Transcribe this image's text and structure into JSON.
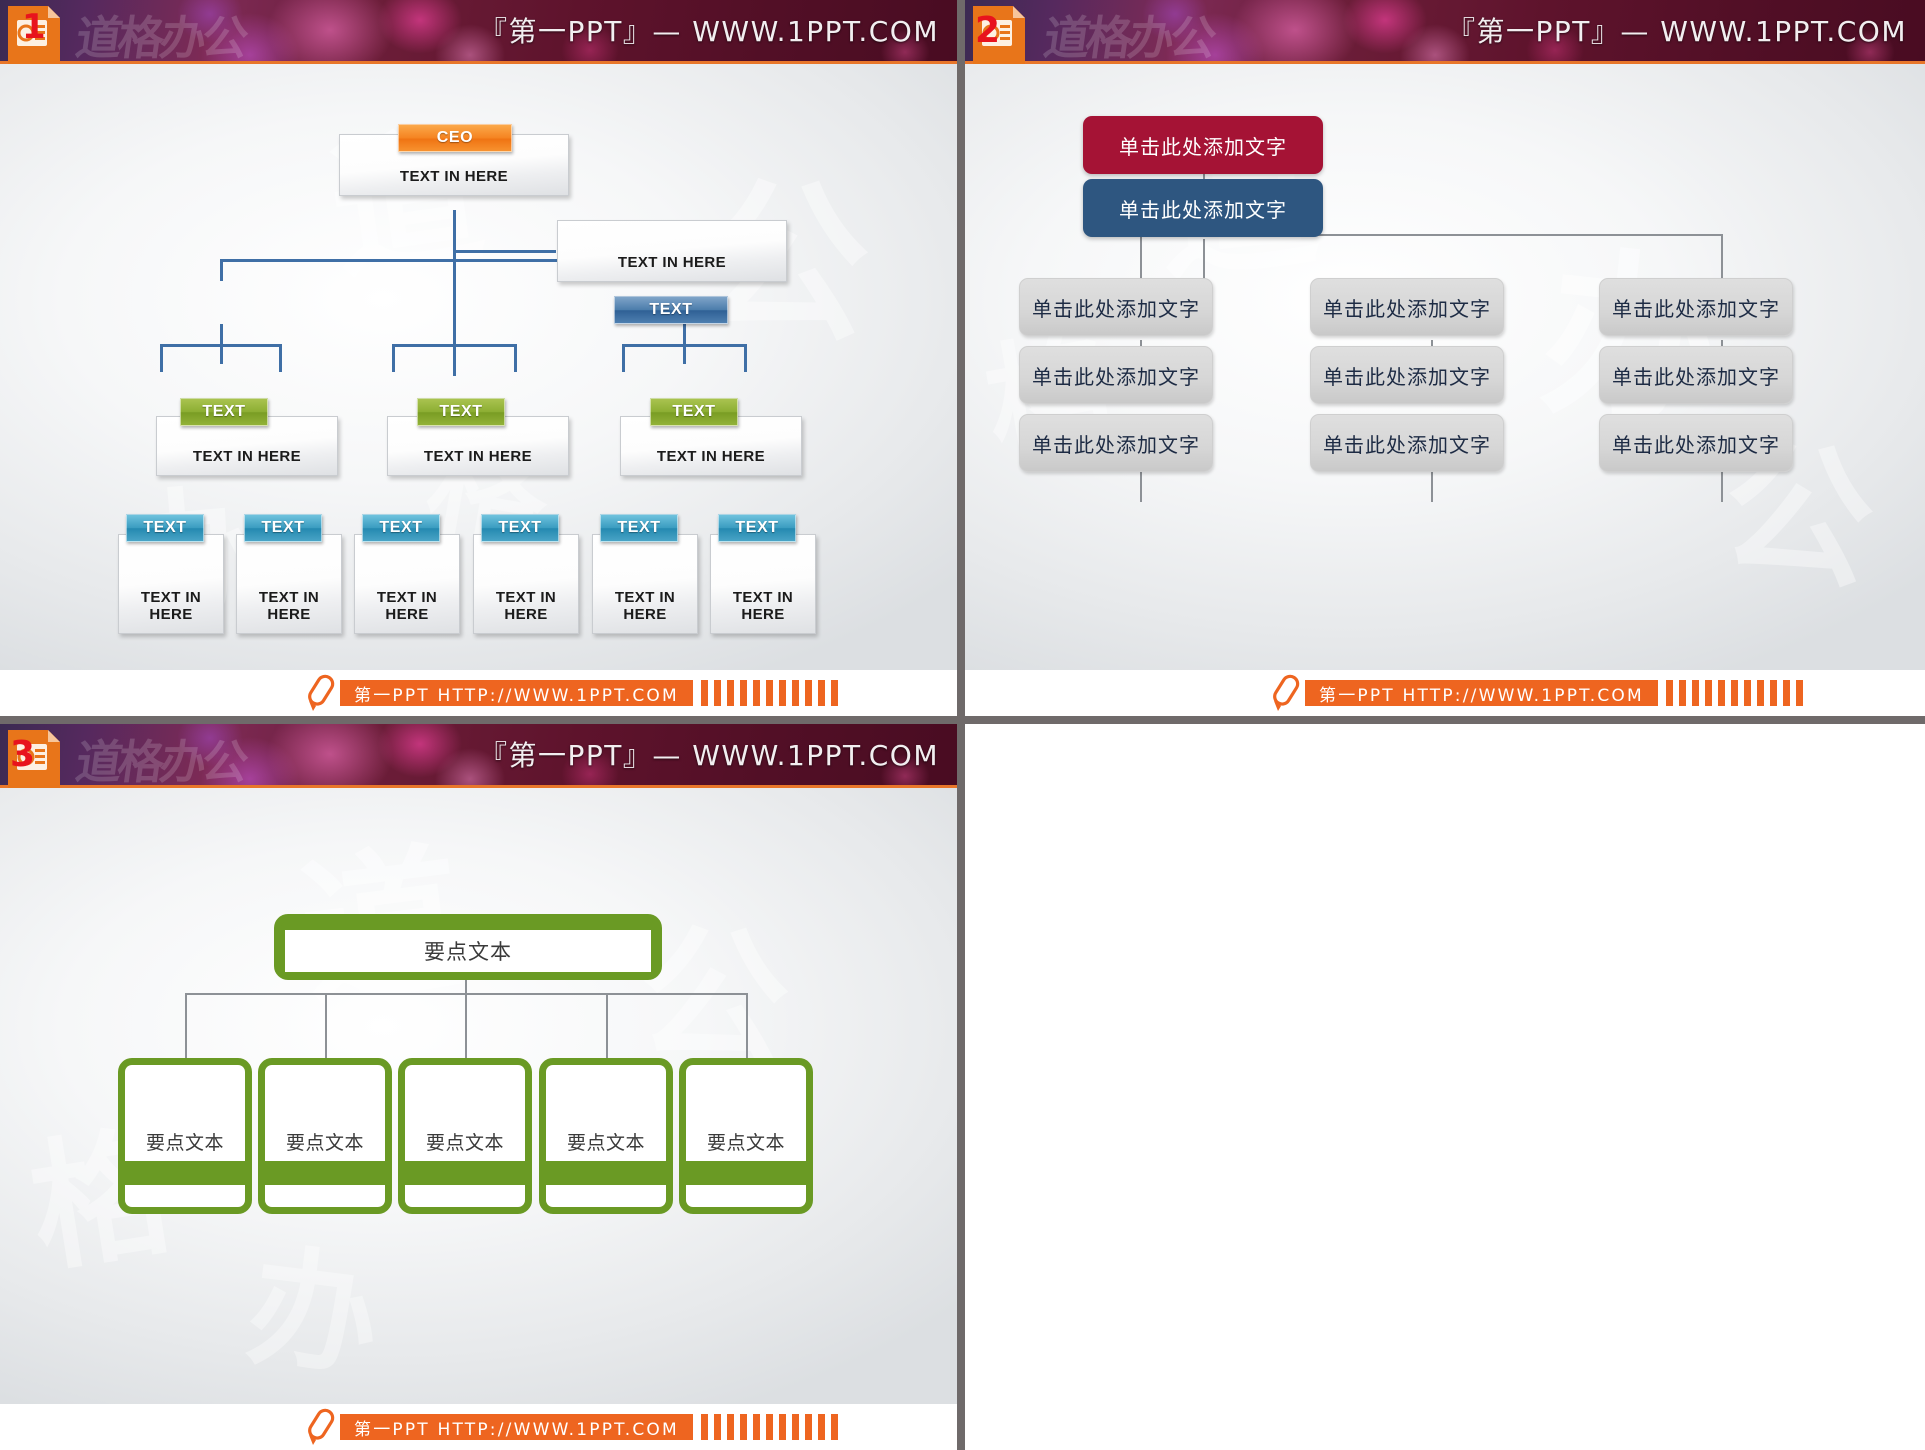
{
  "page": {
    "title": "PPT Organization Chart Template Collection",
    "grid_columns": 2,
    "grid_rows": 2,
    "empty_cell": "bottom-right"
  },
  "banner": {
    "title": "『第一PPT』— WWW.1PPT.COM",
    "watermark": "道格办公",
    "accent_line_color": "#e8762a"
  },
  "footer": {
    "bar_text": "第一PPT HTTP://WWW.1PPT.COM",
    "accent_color": "#ee6520",
    "pen_icon": "pen-icon",
    "tick_count": 11
  },
  "slides": [
    {
      "number": "1",
      "badge_icon": "powerpoint-file-icon",
      "chart_type": "organization-chart-tabbed",
      "colors": {
        "ceo_tab": "#f5821f",
        "level2_tab": "#2f6095",
        "level3_tab": "#8cae33",
        "level4_tab": "#2489b0",
        "connector": "#3f6fa6"
      },
      "nodes": {
        "ceo": {
          "tab": "CEO",
          "body": "TEXT IN HERE"
        },
        "level2": [
          {
            "tab": "TEXT",
            "body": "TEXT IN HERE"
          }
        ],
        "level3": [
          {
            "tab": "TEXT",
            "body": "TEXT IN HERE"
          },
          {
            "tab": "TEXT",
            "body": "TEXT IN HERE"
          },
          {
            "tab": "TEXT",
            "body": "TEXT IN HERE"
          }
        ],
        "level4": [
          {
            "tab": "TEXT",
            "body": "TEXT IN HERE"
          },
          {
            "tab": "TEXT",
            "body": "TEXT IN HERE"
          },
          {
            "tab": "TEXT",
            "body": "TEXT IN HERE"
          },
          {
            "tab": "TEXT",
            "body": "TEXT IN HERE"
          },
          {
            "tab": "TEXT",
            "body": "TEXT IN HERE"
          },
          {
            "tab": "TEXT",
            "body": "TEXT IN HERE"
          }
        ]
      }
    },
    {
      "number": "2",
      "badge_icon": "powerpoint-file-icon",
      "chart_type": "organization-chart-rounded",
      "colors": {
        "top_box": "#a51335",
        "second_box": "#2e5680",
        "grid_box": "#d6d6d6",
        "grid_box_text": "#1d2b44",
        "connector": "#8d9196"
      },
      "nodes": {
        "top": "单击此处添加文字",
        "second": "单击此处添加文字",
        "grid": [
          [
            "单击此处添加文字",
            "单击此处添加文字",
            "单击此处添加文字"
          ],
          [
            "单击此处添加文字",
            "单击此处添加文字",
            "单击此处添加文字"
          ],
          [
            "单击此处添加文字",
            "单击此处添加文字",
            "单击此处添加文字"
          ]
        ]
      }
    },
    {
      "number": "3",
      "badge_icon": "powerpoint-file-icon",
      "chart_type": "organization-chart-green-outline",
      "colors": {
        "outline": "#6a9a24",
        "connector": "#8d9196",
        "text": "#3a3a3a"
      },
      "nodes": {
        "top": "要点文本",
        "children": [
          "要点文本",
          "要点文本",
          "要点文本",
          "要点文本",
          "要点文本"
        ]
      }
    }
  ]
}
